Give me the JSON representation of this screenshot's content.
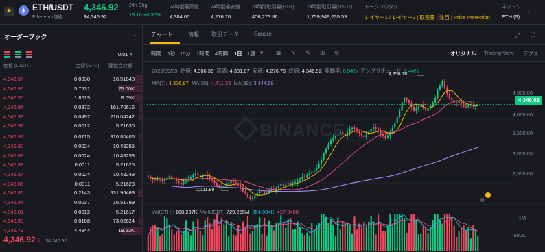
{
  "header": {
    "pair": "ETH/USDT",
    "name": "Ethereum価格",
    "last_price": "4,346.92",
    "last_price_usd": "$4,346.92",
    "stats": [
      {
        "label": "24h Chg",
        "value": "13.10 +0.30%",
        "tone": "g"
      },
      {
        "label": "24時間最高値",
        "value": "4,384.06",
        "tone": ""
      },
      {
        "label": "24時間最安値",
        "value": "4,276.76",
        "tone": ""
      },
      {
        "label": "24時間取引量(ETH)",
        "value": "406,273.86",
        "tone": ""
      },
      {
        "label": "24時間取引量(USDT)",
        "value": "1,759,949,235.53",
        "tone": ""
      },
      {
        "label": "トークンのタグ",
        "value": "レイヤー1 / レイヤー2 | 取引量 | 注目 | Price Protection",
        "tone": "y"
      },
      {
        "label": "ネットワ",
        "value": "ETH (9)",
        "tone": ""
      }
    ],
    "chevron": "›"
  },
  "orderbook": {
    "title": "オーダーブック",
    "more": "···",
    "precision": "0.01",
    "headers": {
      "price": "価格 (USDT)",
      "amount": "金額 (ETH)",
      "total": "建値合計額"
    },
    "rows": [
      {
        "price": "4,346.97",
        "amount": "0.0038",
        "total": "16.51848",
        "depth": 0.05
      },
      {
        "price": "4,346.96",
        "amount": "5.7531",
        "total": "25.00K",
        "depth": 0.17
      },
      {
        "price": "4,346.95",
        "amount": "1.8619",
        "total": "8.09K",
        "depth": 0.06
      },
      {
        "price": "4,346.94",
        "amount": "0.0372",
        "total": "161.70616",
        "depth": 0.02
      },
      {
        "price": "4,346.93",
        "amount": "0.0497",
        "total": "216.04242",
        "depth": 0.02
      },
      {
        "price": "4,346.92",
        "amount": "0.0012",
        "total": "5.21630",
        "depth": 0.01
      },
      {
        "price": "4,346.91",
        "amount": "0.0715",
        "total": "310.80406",
        "depth": 0.02
      },
      {
        "price": "4,346.90",
        "amount": "0.0024",
        "total": "10.43255",
        "depth": 0.01
      },
      {
        "price": "4,346.89",
        "amount": "0.0024",
        "total": "10.43253",
        "depth": 0.01
      },
      {
        "price": "4,346.88",
        "amount": "0.0011",
        "total": "5.21625",
        "depth": 0.01
      },
      {
        "price": "4,346.87",
        "amount": "0.0024",
        "total": "10.43248",
        "depth": 0.01
      },
      {
        "price": "4,346.86",
        "amount": "0.0011",
        "total": "5.21623",
        "depth": 0.01
      },
      {
        "price": "4,346.85",
        "amount": "0.2143",
        "total": "931.96463",
        "depth": 0.03
      },
      {
        "price": "4,346.84",
        "amount": "0.0037",
        "total": "16.51799",
        "depth": 0.01
      },
      {
        "price": "4,346.81",
        "amount": "0.0012",
        "total": "5.21617",
        "depth": 0.01
      },
      {
        "price": "4,346.80",
        "amount": "0.0168",
        "total": "73.02624",
        "depth": 0.02
      },
      {
        "price": "4,346.79",
        "amount": "4.4944",
        "total": "19.53K",
        "depth": 0.15
      }
    ],
    "current_price": "4,346.92",
    "current_arrow": "↓",
    "current_usd": "$4,346.92"
  },
  "chart_tabs": {
    "chart": "チャート",
    "info": "情報",
    "trade_data": "取引データ",
    "square": "Square"
  },
  "toolbar": {
    "time_label": "時間",
    "intervals": [
      "1秒",
      "15分",
      "1時間",
      "4時間",
      "1日",
      "1週"
    ],
    "active_interval": "1日",
    "views": [
      "オリジナル",
      "Trading View",
      "デプス"
    ],
    "active_view": "オリジナル"
  },
  "ohlc": {
    "date": "2025/09/09",
    "open_label": "始値:",
    "open": "4,306.36",
    "high_label": "高値:",
    "high": "4,381.87",
    "low_label": "安値:",
    "low": "4,276.76",
    "close_label": "終値:",
    "close": "4,346.92",
    "change_label": "変動率:",
    "change": "0.94%",
    "amp_label": "アンプリチュード:",
    "amp": "2.44%"
  },
  "ma": {
    "ma7_label": "MA(7):",
    "ma7": "4,326.87",
    "ma25_label": "MA(25):",
    "ma25": "4,411.38",
    "ma99_label": "MA(99):",
    "ma99": "3,444.59"
  },
  "volume": {
    "label": "Vol(ETH):",
    "eth": "168.237K",
    "usdt_label": "Vol(USDT)",
    "usdt": "729.255M",
    "ma1": "354.994K",
    "ma2": "427.948K"
  },
  "annotations": {
    "high": "4,956.78",
    "low": "2,111.89"
  },
  "watermark": "BINANCE",
  "price_tag": "4,346.92",
  "colors": {
    "up": "#0ecb81",
    "down": "#f6465d",
    "ma7": "#f0b90b",
    "ma25": "#e04d8a",
    "ma99": "#a58bfb",
    "accent": "#f0b90b"
  },
  "chart_data": {
    "type": "candlestick",
    "y_axis": {
      "ticks": [
        2500,
        3000,
        3500,
        4000,
        4500
      ],
      "tick_labels": [
        "2,500.00",
        "3,000.00",
        "3,500.00",
        "4,000.00",
        "4,500.00"
      ],
      "ylim": [
        2050,
        5050
      ]
    },
    "volume_axis": {
      "ticks": [
        1000000,
        500000
      ],
      "tick_labels": [
        "1M",
        "500K"
      ]
    },
    "candles_closes": [
      2640,
      2610,
      2580,
      2570,
      2600,
      2580,
      2550,
      2590,
      2620,
      2660,
      2600,
      2580,
      2530,
      2500,
      2480,
      2520,
      2560,
      2600,
      2640,
      2690,
      2720,
      2680,
      2640,
      2670,
      2700,
      2650,
      2600,
      2560,
      2500,
      2440,
      2410,
      2380,
      2420,
      2460,
      2500,
      2540,
      2520,
      2480,
      2440,
      2400,
      2300,
      2250,
      2180,
      2120,
      2140,
      2200,
      2260,
      2300,
      2280,
      2240,
      2260,
      2320,
      2360,
      2340,
      2380,
      2420,
      2480,
      2440,
      2460,
      2500,
      2470,
      2500,
      2520,
      2560,
      2600,
      2640,
      2620,
      2680,
      2720,
      2760,
      2800,
      2860,
      2940,
      3050,
      3200,
      3300,
      3420,
      3500,
      3560,
      3600,
      3650,
      3700,
      3660,
      3620,
      3700,
      3760,
      3800,
      3760,
      3720,
      3680,
      3620,
      3580,
      3640,
      3700,
      3760,
      3820,
      3780,
      3720,
      3660,
      3600,
      3560,
      3620,
      3700,
      3800,
      3920,
      4050,
      4200,
      4400,
      4500,
      4450,
      4380,
      4300,
      4200,
      4250,
      4300,
      4350,
      4280,
      4200,
      4260,
      4320,
      4400,
      4500,
      4700,
      4800,
      4900,
      4750,
      4600,
      4500,
      4450,
      4400,
      4380,
      4420,
      4350,
      4300,
      4280,
      4320,
      4340,
      4300,
      4320,
      4347
    ],
    "ma7": 4326.87,
    "ma25": 4411.38,
    "ma99": 3444.59,
    "last": 4346.92,
    "high_marker": 4956.78,
    "low_marker": 2111.89
  }
}
